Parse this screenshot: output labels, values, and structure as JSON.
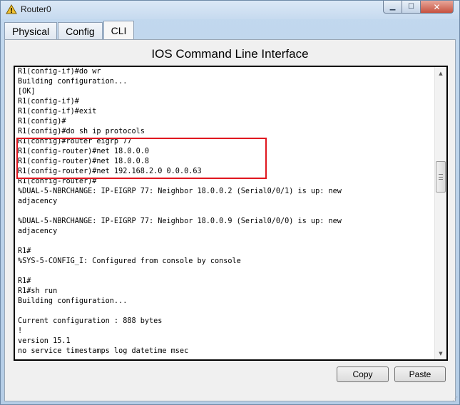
{
  "window": {
    "title": "Router0",
    "controls": {
      "minimize": "▁",
      "maximize": "☐",
      "close": "✕"
    }
  },
  "tabs": [
    {
      "label": "Physical",
      "active": false
    },
    {
      "label": "Config",
      "active": false
    },
    {
      "label": "CLI",
      "active": true
    }
  ],
  "panel": {
    "title": "IOS Command Line Interface"
  },
  "console": {
    "lines": [
      "R1(config-if)#do wr",
      "Building configuration...",
      "[OK]",
      "R1(config-if)#",
      "R1(config-if)#exit",
      "R1(config)#",
      "R1(config)#do sh ip protocols",
      "R1(config)#router eigrp 77",
      "R1(config-router)#net 18.0.0.0",
      "R1(config-router)#net 18.0.0.8",
      "R1(config-router)#net 192.168.2.0 0.0.0.63",
      "R1(config-router)#",
      "%DUAL-5-NBRCHANGE: IP-EIGRP 77: Neighbor 18.0.0.2 (Serial0/0/1) is up: new",
      "adjacency",
      "",
      "%DUAL-5-NBRCHANGE: IP-EIGRP 77: Neighbor 18.0.0.9 (Serial0/0/0) is up: new",
      "adjacency",
      "",
      "R1#",
      "%SYS-5-CONFIG_I: Configured from console by console",
      "",
      "R1#",
      "R1#sh run",
      "Building configuration...",
      "",
      "Current configuration : 888 bytes",
      "!",
      "version 15.1",
      "no service timestamps log datetime msec"
    ],
    "highlight_color": "#e0171f"
  },
  "scrollbar": {
    "up_icon": "▲",
    "down_icon": "▼"
  },
  "buttons": {
    "copy": "Copy",
    "paste": "Paste"
  },
  "colors": {
    "accent_frame": "#c2d8ee",
    "close_button": "#c6513f"
  }
}
